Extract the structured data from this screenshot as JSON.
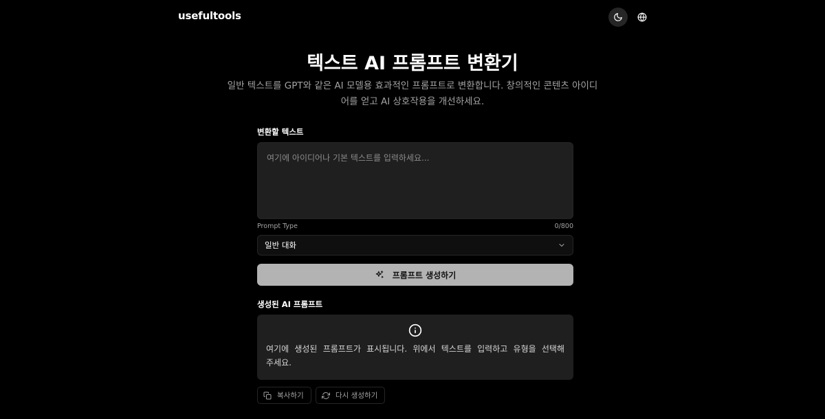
{
  "header": {
    "logo": "usefultools",
    "theme_icon": "moon-icon",
    "language_icon": "globe-icon"
  },
  "page": {
    "title": "텍스트 AI 프롬프트 변환기",
    "description": "일반 텍스트를 GPT와 같은 AI 모델용 효과적인 프롬프트로 변환합니다. 창의적인 콘텐츠 아이디어를 얻고 AI 상호작용을 개선하세요."
  },
  "input": {
    "label": "변환할 텍스트",
    "value": "",
    "placeholder": "여기에 아이디어나 기본 텍스트를 입력하세요...",
    "char_count": "0/800"
  },
  "prompt_type": {
    "label": "Prompt Type",
    "selected": "일반 대화",
    "icon": "chevron-down-icon"
  },
  "generate_button": {
    "label": "프롬프트 생성하기",
    "icon": "sparkles-icon"
  },
  "output": {
    "label": "생성된 AI 프롬프트",
    "icon": "info-icon",
    "placeholder_text": "여기에 생성된 프롬프트가 표시됩니다. 위에서 텍스트를 입력하고 유형을 선택해주세요."
  },
  "actions": {
    "copy_label": "복사하기",
    "copy_icon": "copy-icon",
    "regenerate_label": "다시 생성하기",
    "regenerate_icon": "refresh-icon"
  },
  "colors": {
    "background": "#000000",
    "surface": "#1f1f1f",
    "border": "#262626",
    "muted_text": "#a3a3a3",
    "primary_button": "#b3b3b3"
  }
}
